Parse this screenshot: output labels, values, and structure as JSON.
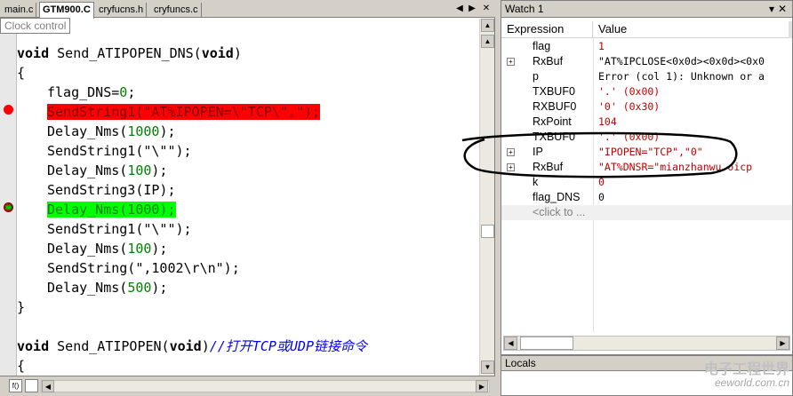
{
  "editor": {
    "tabs": [
      {
        "label": "main.c",
        "active": false
      },
      {
        "label": "GTM900.C",
        "active": true
      },
      {
        "label": "cryfucns.h",
        "active": false
      },
      {
        "label": "cryfuncs.c",
        "active": false
      }
    ],
    "tooltip": "Clock control",
    "lines": [
      {
        "text": "void Send_ATIPOPEN_DNS(void)",
        "type": "func-sig"
      },
      {
        "text": "{",
        "type": "plain"
      },
      {
        "text": "flag_DNS=0;",
        "type": "plain"
      },
      {
        "text": "SendString1(\"AT%IPOPEN=\\\"TCP\\\",\");",
        "type": "breakpoint"
      },
      {
        "text": "Delay_Nms(1000);",
        "type": "plain"
      },
      {
        "text": "SendString1(\"\\\"\");",
        "type": "plain"
      },
      {
        "text": "Delay_Nms(100);",
        "type": "plain"
      },
      {
        "text": "SendString3(IP);",
        "type": "plain"
      },
      {
        "text": "Delay_Nms(1000);",
        "type": "current"
      },
      {
        "text": "SendString1(\"\\\"\");",
        "type": "plain"
      },
      {
        "text": "Delay_Nms(100);",
        "type": "plain"
      },
      {
        "text": "SendString(\",1002\\r\\n\");",
        "type": "plain"
      },
      {
        "text": "Delay_Nms(500);",
        "type": "plain"
      },
      {
        "text": "}",
        "type": "plain"
      },
      {
        "text": "",
        "type": "plain"
      },
      {
        "text": "void Send_ATIPOPEN(void)//打开TCP或UDP链接命令",
        "type": "func-sig-comment"
      },
      {
        "text": "{",
        "type": "plain"
      }
    ]
  },
  "watch": {
    "title": "Watch 1",
    "columns": {
      "expression": "Expression",
      "value": "Value"
    },
    "rows": [
      {
        "name": "flag",
        "value": "1",
        "expandable": false,
        "value_color": "#c00000"
      },
      {
        "name": "RxBuf",
        "value": "\"AT%IPCLOSE<0x0d><0x0d><0x0",
        "expandable": true,
        "value_color": "#000000"
      },
      {
        "name": "p",
        "value": "Error (col 1): Unknown or a",
        "expandable": false,
        "value_color": "#000000"
      },
      {
        "name": "TXBUF0",
        "value": "'.' (0x00)",
        "expandable": false,
        "value_color": "#c00000"
      },
      {
        "name": "RXBUF0",
        "value": "'0' (0x30)",
        "expandable": false,
        "value_color": "#c00000"
      },
      {
        "name": "RxPoint",
        "value": "104",
        "expandable": false,
        "value_color": "#c00000"
      },
      {
        "name": "TXBUF0",
        "value": "'.' (0x00)",
        "expandable": false,
        "value_color": "#c00000"
      },
      {
        "name": "IP",
        "value": "\"IPOPEN=\"TCP\",\"0\"",
        "expandable": true,
        "value_color": "#c00000"
      },
      {
        "name": "RxBuf",
        "value": "\"AT%DNSR=\"mianzhanwu.oicp",
        "expandable": true,
        "value_color": "#c00000"
      },
      {
        "name": "k",
        "value": "0",
        "expandable": false,
        "value_color": "#c00000"
      },
      {
        "name": "flag_DNS",
        "value": "0",
        "expandable": false,
        "value_color": "#000000"
      },
      {
        "name": "<click to ...",
        "value": "",
        "expandable": false,
        "value_color": "#000000",
        "placeholder": true
      }
    ]
  },
  "locals": {
    "title": "Locals"
  },
  "watermark": {
    "main": "电子工程世界",
    "sub": "eeworld.com.cn"
  },
  "colors": {
    "breakpoint": "#ff0000",
    "current_line": "#00ff00",
    "number": "#008000",
    "comment": "#0000ff"
  }
}
